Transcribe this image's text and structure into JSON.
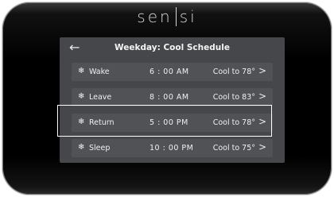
{
  "brand": {
    "left": "sen",
    "right": "si"
  },
  "header": {
    "back_icon": "←",
    "title": "Weekday: Cool Schedule"
  },
  "rows": [
    {
      "icon": "❄",
      "name": "Wake",
      "time": "6 : 00 AM",
      "setting": "Cool to 78°",
      "chevron": ">",
      "selected": false
    },
    {
      "icon": "❄",
      "name": "Leave",
      "time": "8 : 00 AM",
      "setting": "Cool to 83°",
      "chevron": ">",
      "selected": false
    },
    {
      "icon": "❄",
      "name": "Return",
      "time": "5 : 00 PM",
      "setting": "Cool to 78°",
      "chevron": ">",
      "selected": true
    },
    {
      "icon": "❄",
      "name": "Sleep",
      "time": "10 : 00 PM",
      "setting": "Cool to 75°",
      "chevron": ">",
      "selected": false
    }
  ],
  "colors": {
    "screen": "#45474b",
    "row": "#505256",
    "selection": "#ffffff"
  }
}
